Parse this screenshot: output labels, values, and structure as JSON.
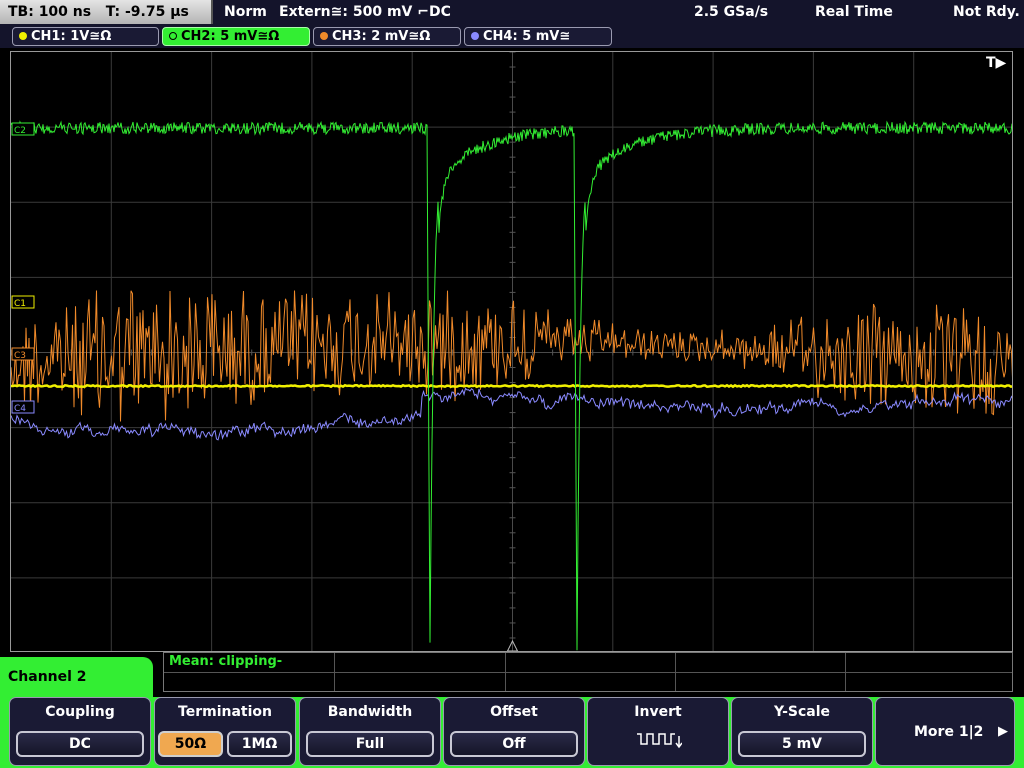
{
  "status_bar": {
    "timebase": "TB: 100 ns",
    "trigger_time": "T: -9.75 µs",
    "trigger_mode": "Norm",
    "trigger_source": "Extern≅: 500 mV ⌐DC",
    "sample_rate": "2.5 GSa/s",
    "acquisition_mode": "Real Time",
    "trigger_status": "Not Rdy."
  },
  "channels": [
    {
      "label": "CH1: 1V≅Ω",
      "color": "#f0f000",
      "active": false
    },
    {
      "label": "CH2: 5 mV≅Ω",
      "color": "#33ee33",
      "active": true
    },
    {
      "label": "CH3: 2 mV≅Ω",
      "color": "#f08a2a",
      "active": false
    },
    {
      "label": "CH4: 5 mV≅",
      "color": "#8a8aff",
      "active": false
    }
  ],
  "screen": {
    "trigger_marker": "T▶",
    "channel_markers": [
      "C1",
      "C2",
      "C3",
      "C4"
    ]
  },
  "measurement": {
    "text": "Mean: clipping-"
  },
  "menu": {
    "title": "Channel 2",
    "softkeys": {
      "coupling": {
        "title": "Coupling",
        "value": "DC"
      },
      "termination": {
        "title": "Termination",
        "options": [
          "50Ω",
          "1MΩ"
        ],
        "selected": "50Ω"
      },
      "bandwidth": {
        "title": "Bandwidth",
        "value": "Full"
      },
      "offset": {
        "title": "Offset",
        "value": "Off"
      },
      "invert": {
        "title": "Invert",
        "icon": "square-wave-invert-icon"
      },
      "y_scale": {
        "title": "Y-Scale",
        "value": "5 mV"
      },
      "more": {
        "label": "More 1|2",
        "icon": "arrow-right-icon"
      }
    }
  },
  "colors": {
    "ch1": "#f0f000",
    "ch2": "#33ee33",
    "ch3": "#f08a2a",
    "ch4": "#8a8aff",
    "menu_accent": "#33ee33",
    "selected_option": "#f0a850"
  }
}
